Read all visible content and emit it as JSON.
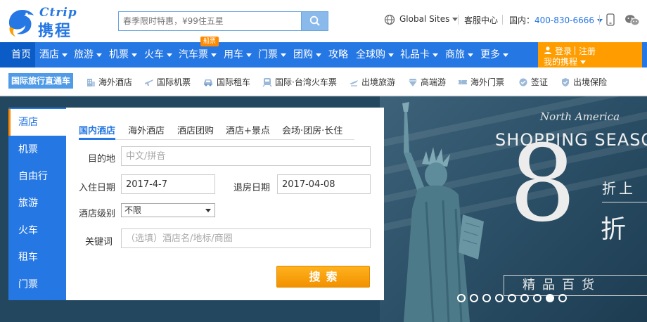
{
  "brand": {
    "logo_en": "Ctrip",
    "logo_cn": "携程"
  },
  "search": {
    "placeholder": "春季限时特惠，¥99住五星"
  },
  "top_links": {
    "global_sites": "Global Sites",
    "customer_service": "客服中心",
    "domestic_label": "国内：",
    "phone": "400-830-6666"
  },
  "main_nav": [
    {
      "label": "首页",
      "dropdown": false,
      "active": true
    },
    {
      "label": "酒店",
      "dropdown": true
    },
    {
      "label": "旅游",
      "dropdown": true
    },
    {
      "label": "机票",
      "dropdown": true
    },
    {
      "label": "火车",
      "dropdown": true
    },
    {
      "label": "汽车票",
      "dropdown": true
    },
    {
      "label": "用车",
      "dropdown": true
    },
    {
      "label": "门票",
      "dropdown": true
    },
    {
      "label": "团购",
      "dropdown": true
    },
    {
      "label": "攻略",
      "dropdown": false
    },
    {
      "label": "全球购",
      "dropdown": true
    },
    {
      "label": "礼品卡",
      "dropdown": true
    },
    {
      "label": "商旅",
      "dropdown": true
    },
    {
      "label": "更多",
      "dropdown": true
    }
  ],
  "bus_badge": "船票",
  "member": {
    "login": "登录",
    "register": "注册",
    "my_ctrip": "我的携程"
  },
  "sub_nav": {
    "tag": "国际旅行直通车",
    "items": [
      {
        "label": "海外酒店",
        "icon": "building-icon"
      },
      {
        "label": "国际机票",
        "icon": "plane-icon"
      },
      {
        "label": "国际租车",
        "icon": "car-icon"
      },
      {
        "label": "国际·台湾火车票",
        "icon": "train-icon"
      },
      {
        "label": "出境旅游",
        "icon": "travel-icon"
      },
      {
        "label": "高端游",
        "icon": "diamond-icon"
      },
      {
        "label": "海外门票",
        "icon": "ticket-icon"
      },
      {
        "label": "签证",
        "icon": "visa-icon"
      },
      {
        "label": "出境保险",
        "icon": "shield-icon"
      }
    ]
  },
  "side_tabs": [
    {
      "label": "酒店",
      "active": true
    },
    {
      "label": "机票"
    },
    {
      "label": "自由行"
    },
    {
      "label": "旅游"
    },
    {
      "label": "火车"
    },
    {
      "label": "租车"
    },
    {
      "label": "门票"
    }
  ],
  "hotel_tabs": [
    {
      "label": "国内酒店",
      "active": true
    },
    {
      "label": "海外酒店"
    },
    {
      "label": "酒店团购"
    },
    {
      "label": "酒店+景点"
    },
    {
      "label": "会场·团房·长住"
    }
  ],
  "form": {
    "destination_label": "目的地",
    "destination_placeholder": "中文/拼音",
    "checkin_label": "入住日期",
    "checkin_value": "2017-4-7",
    "checkout_label": "退房日期",
    "checkout_value": "2017-04-08",
    "level_label": "酒店级别",
    "level_value": "不限",
    "keyword_label": "关键词",
    "keyword_placeholder": "（选填）酒店名/地标/商圈",
    "submit": "搜索"
  },
  "banner": {
    "line1": "North America",
    "line2": "SHOPPING SEASON",
    "digit": "8",
    "zheshang": "折上",
    "zhe": "折",
    "tag": "精品百货",
    "dots_count": 9,
    "active_dot": 8
  },
  "colors": {
    "primary": "#2577e3",
    "accent": "#ff9d00",
    "nav_active": "#0b5cc7"
  }
}
